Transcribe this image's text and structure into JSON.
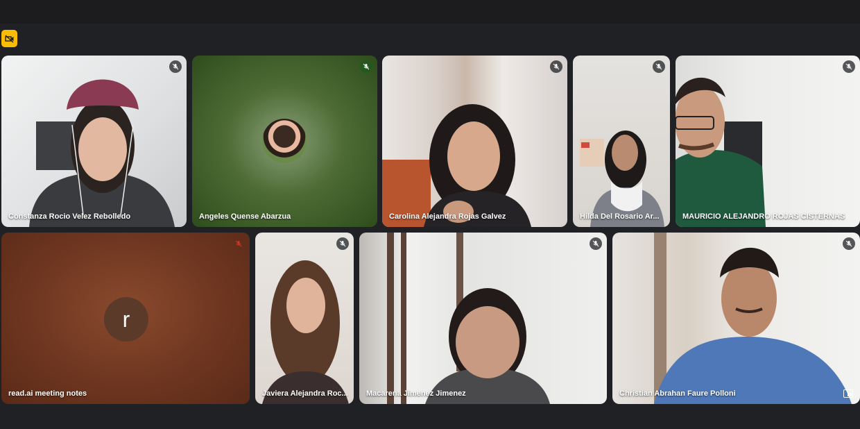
{
  "meeting": {
    "recording_icon": "camera-off-icon",
    "participants": [
      {
        "name": "Constanza Rocio Velez Rebolledo",
        "mic": "muted"
      },
      {
        "name": "Angeles Quense Abarzua",
        "mic": "speaking"
      },
      {
        "name": "Carolina Alejandra Rojas Galvez",
        "mic": "muted"
      },
      {
        "name": "Hilda Del Rosario Ar...",
        "mic": "muted"
      },
      {
        "name": "MAURICIO ALEJANDRO ROJAS CISTERNAS",
        "mic": "muted"
      },
      {
        "name": "read.ai meeting notes",
        "mic": "muted-red",
        "avatar_letter": "r"
      },
      {
        "name": "Javiera Alejandra Roc...",
        "mic": "muted"
      },
      {
        "name": "Macarena Jimenez Jimenez",
        "mic": "muted"
      },
      {
        "name": "Christian Abrahan Faure Polloni",
        "mic": "muted"
      }
    ]
  },
  "colors": {
    "background": "#202124",
    "badge": "#fbbc04",
    "mute_red": "#d93025"
  }
}
